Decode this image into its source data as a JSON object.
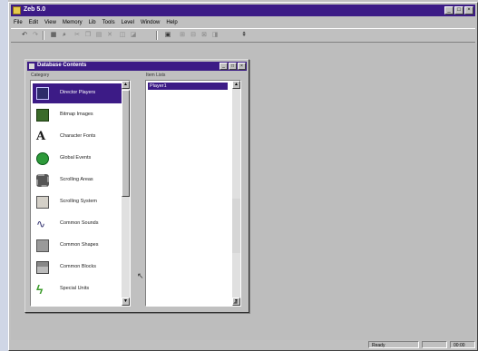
{
  "app": {
    "title": "Zeb 5.0",
    "menus": [
      "File",
      "Edit",
      "View",
      "Memory",
      "Lib",
      "Tools",
      "Level",
      "Window",
      "Help"
    ],
    "status": {
      "left": "",
      "mid": "Ready",
      "right": "00:00"
    }
  },
  "dialog": {
    "title": "Database Contents",
    "category_label": "Category",
    "items_label": "Item Lists",
    "categories": [
      {
        "label": "Director Players",
        "icon": "player-icon",
        "selected": true
      },
      {
        "label": "Bitmap Images",
        "icon": "bitmap-icon",
        "selected": false
      },
      {
        "label": "Character Fonts",
        "icon": "font-icon",
        "selected": false
      },
      {
        "label": "Global Events",
        "icon": "globe-icon",
        "selected": false
      },
      {
        "label": "Scrolling Areas",
        "icon": "gear-icon",
        "selected": false
      },
      {
        "label": "Scrolling System",
        "icon": "system-icon",
        "selected": false
      },
      {
        "label": "Common Sounds",
        "icon": "wave-icon",
        "selected": false
      },
      {
        "label": "Common Shapes",
        "icon": "shape-icon",
        "selected": false
      },
      {
        "label": "Common Blocks",
        "icon": "blocks-icon",
        "selected": false
      },
      {
        "label": "Special Units",
        "icon": "bolt-icon",
        "selected": false
      }
    ],
    "items": [
      {
        "label": "Player1",
        "selected": true
      }
    ]
  }
}
